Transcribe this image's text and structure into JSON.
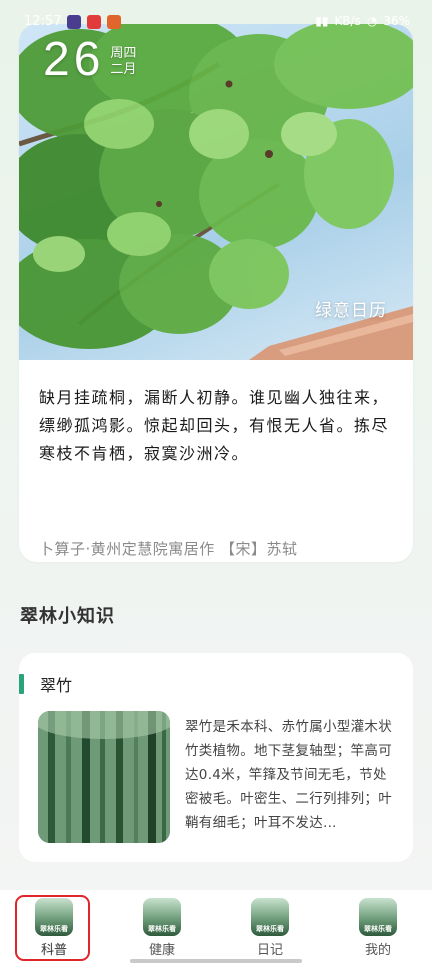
{
  "status_bar": {
    "time": "12:57",
    "battery": "36%",
    "network": "KB/s"
  },
  "calendar": {
    "day": "26",
    "weekday": "周四",
    "month": "二月",
    "brand": "绿意日历",
    "poem": "缺月挂疏桐，漏断人初静。谁见幽人独往来，缥缈孤鸿影。惊起却回头，有恨无人省。拣尽寒枝不肯栖，寂寞沙洲冷。",
    "source": "卜算子·黄州定慧院寓居作  【宋】苏轼"
  },
  "knowledge": {
    "section_title": "翠林小知识",
    "title": "翠竹",
    "description": "翠竹是禾本科、赤竹属小型灌木状竹类植物。地下茎复轴型；竿高可达0.4米，竿箨及节间无毛，节处密被毛。叶密生、二行列排列；叶鞘有细毛；叶耳不发达…"
  },
  "nav": {
    "icon_caption": "翠林乐看",
    "items": [
      {
        "label": "科普"
      },
      {
        "label": "健康"
      },
      {
        "label": "日记"
      },
      {
        "label": "我的"
      }
    ]
  },
  "colors": {
    "accent": "#2aa37a",
    "highlight": "#e0262a"
  }
}
